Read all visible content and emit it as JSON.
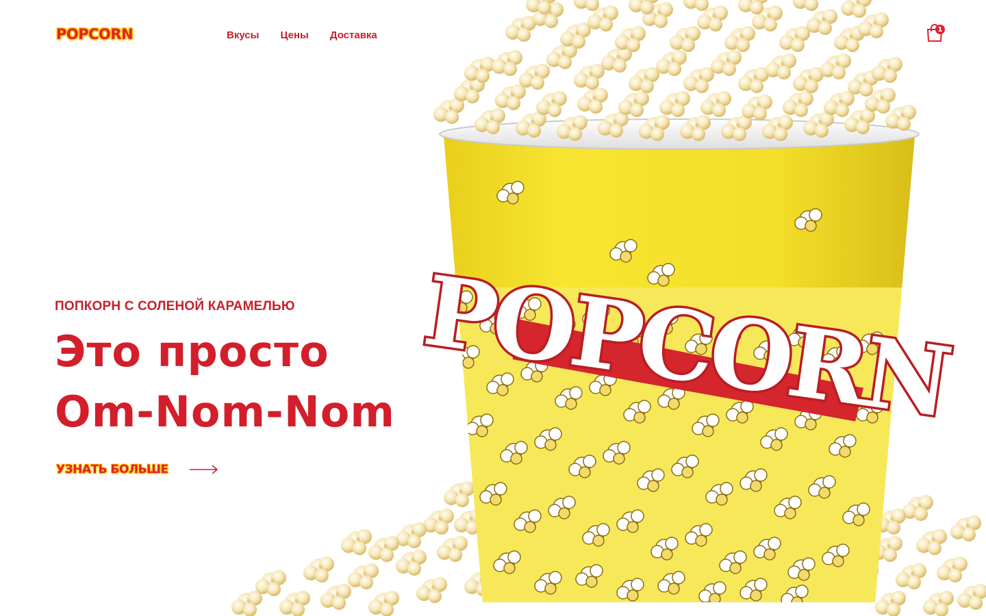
{
  "header": {
    "logo_text": "POPCORN",
    "nav": [
      {
        "label": "Вкусы"
      },
      {
        "label": "Цены"
      },
      {
        "label": "Доставка"
      }
    ],
    "cart": {
      "icon": "shopping-bag-icon",
      "count": "1"
    }
  },
  "hero": {
    "subtitle": "ПОПКОРН С СОЛЕНОЙ КАРАМЕЛЬЮ",
    "headline_line1": "Это просто",
    "headline_line2": "Om-Nom-Nom",
    "cta_label": "УЗНАТЬ БОЛЬШЕ",
    "cta_icon": "arrow-right-icon",
    "image": {
      "subject": "popcorn-bucket",
      "bucket_text": "POPCORN"
    }
  },
  "colors": {
    "brand_red": "#d21f2b",
    "brand_yellow": "#ffd21a",
    "background": "#ffffff"
  }
}
